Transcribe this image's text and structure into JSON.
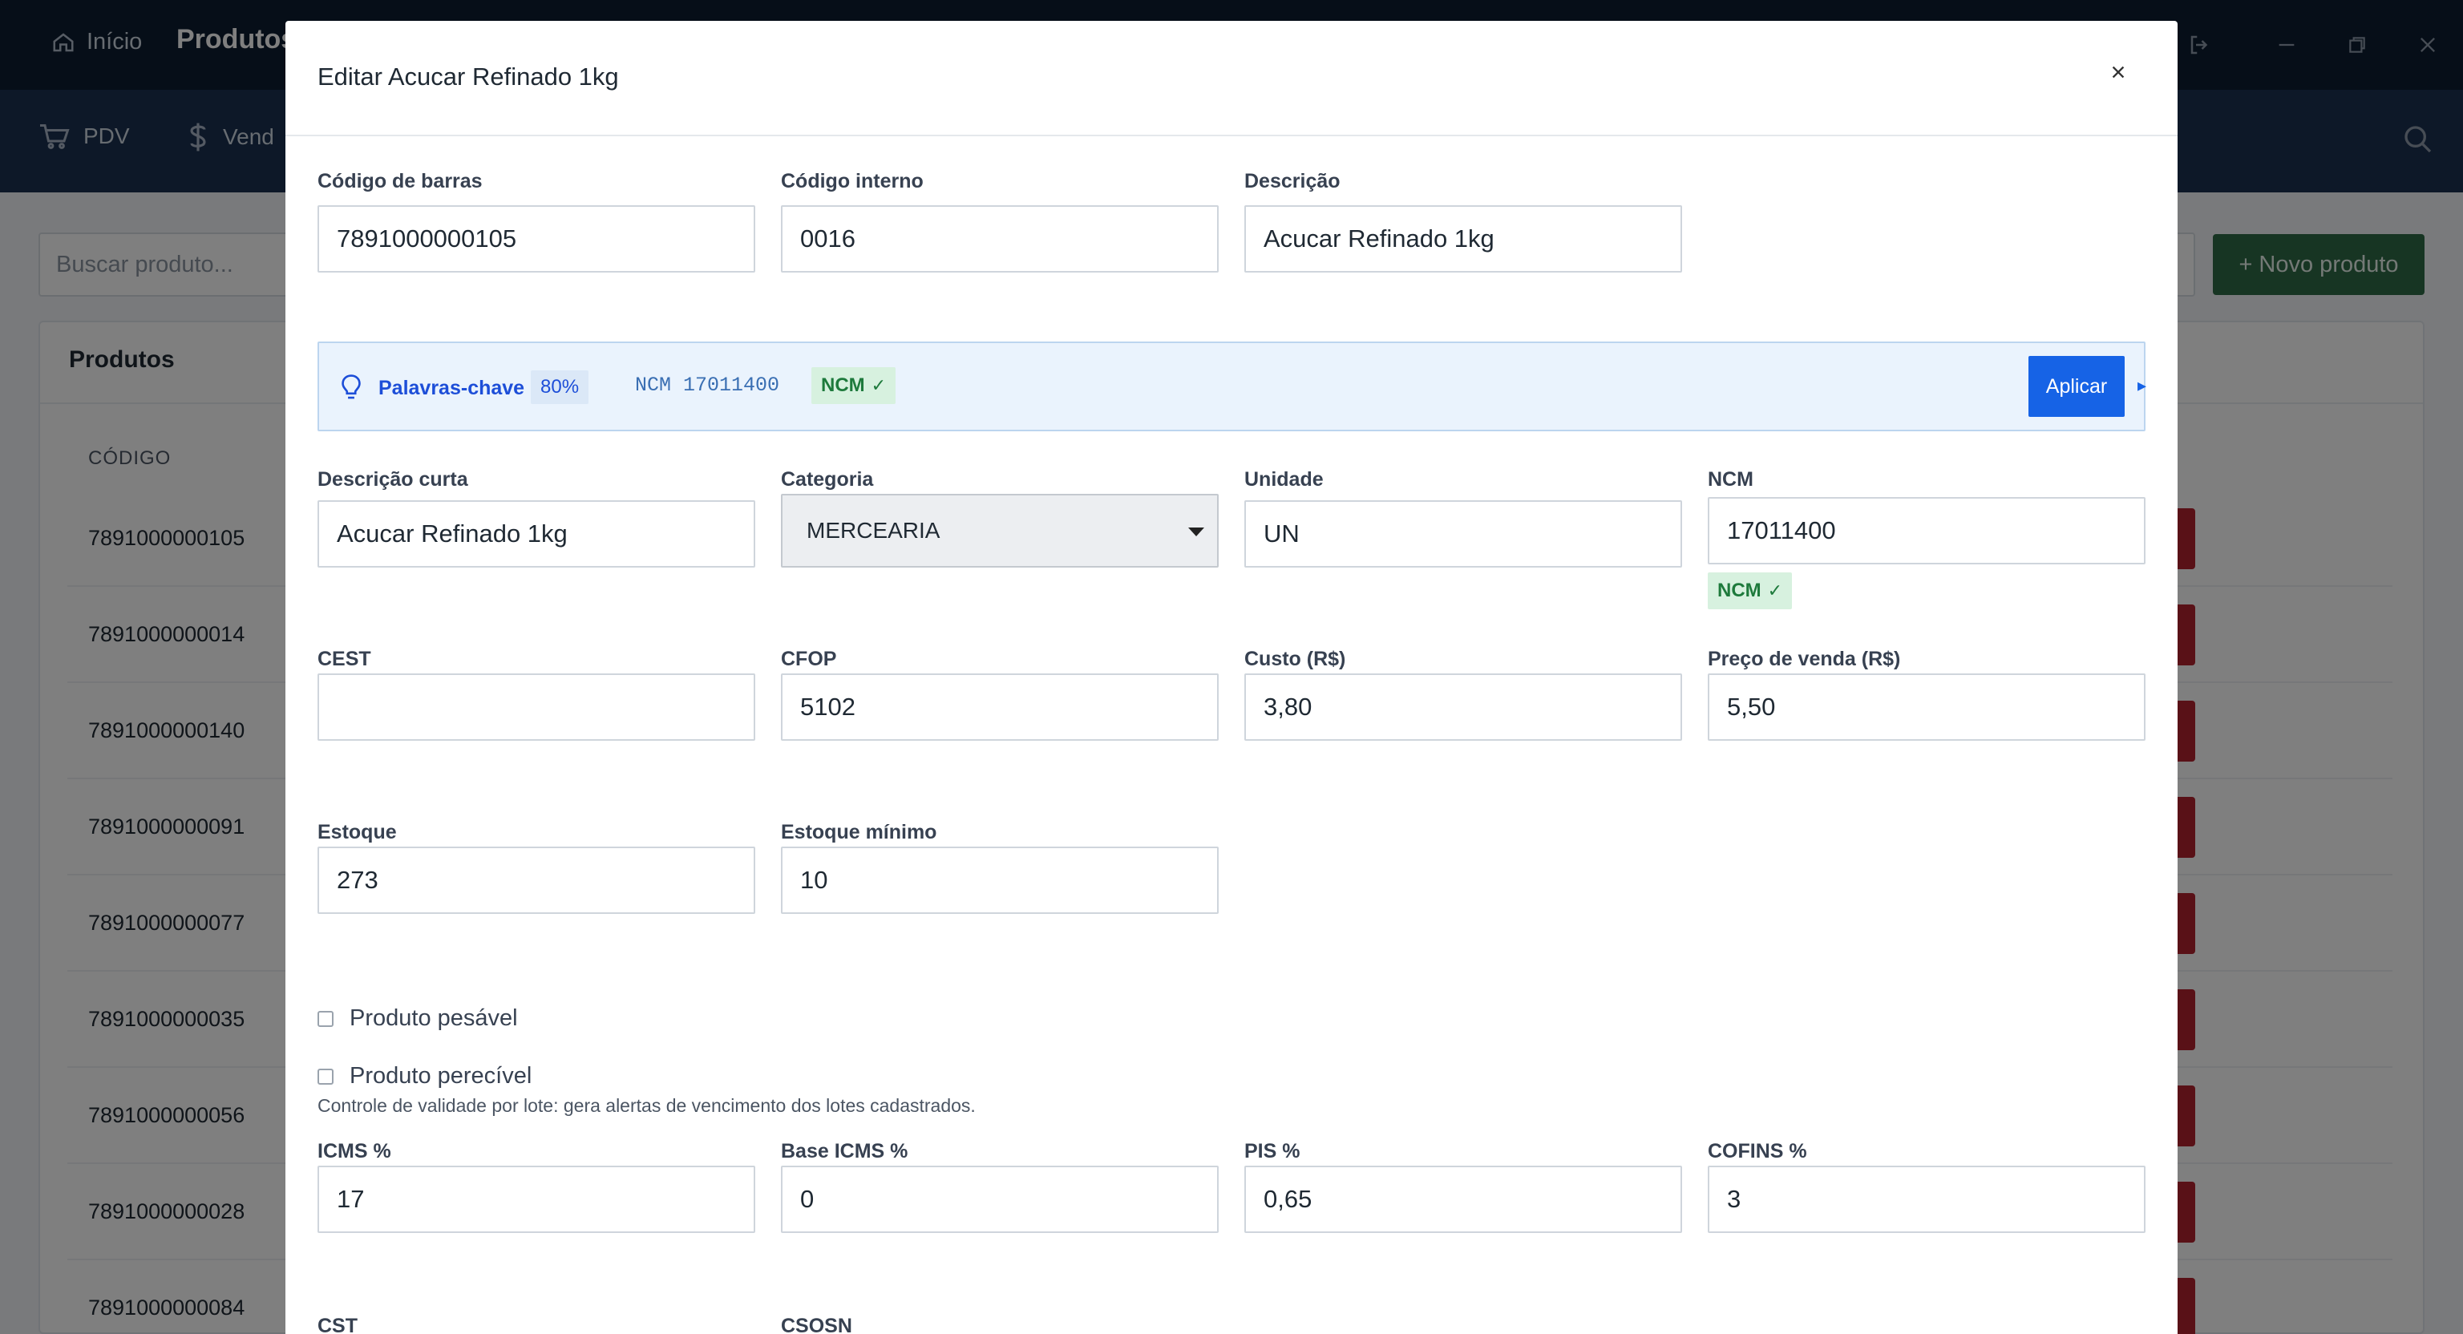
{
  "titlebar": {
    "home_label": "Início",
    "active_label": "Produtos"
  },
  "nav": {
    "items": [
      {
        "label": "PDV",
        "icon": "cart-icon"
      },
      {
        "label": "Vend",
        "icon": "dollar-icon"
      }
    ]
  },
  "background": {
    "search_placeholder": "Buscar produto...",
    "new_button": "+ Novo produto",
    "panel_title": "Produtos",
    "column_code": "CÓDIGO",
    "rows": [
      "7891000000105",
      "7891000000014",
      "7891000000140",
      "7891000000091",
      "7891000000077",
      "7891000000035",
      "7891000000056",
      "7891000000028",
      "7891000000084"
    ],
    "delete_color": "#b3232e"
  },
  "modal": {
    "title": "Editar Acucar Refinado 1kg",
    "close_label": "×",
    "fields": {
      "barcode": {
        "label": "Código de barras",
        "value": "7891000000105"
      },
      "internal_code": {
        "label": "Código interno",
        "value": "0016"
      },
      "description": {
        "label": "Descrição",
        "value": "Acucar Refinado 1kg"
      },
      "short_description": {
        "label": "Descrição curta",
        "value": "Acucar Refinado 1kg"
      },
      "category": {
        "label": "Categoria",
        "value": "MERCEARIA"
      },
      "unit": {
        "label": "Unidade",
        "value": "UN"
      },
      "ncm": {
        "label": "NCM",
        "value": "17011400",
        "badge": "NCM"
      },
      "cest": {
        "label": "CEST",
        "value": ""
      },
      "cfop": {
        "label": "CFOP",
        "value": "5102"
      },
      "cost": {
        "label": "Custo (R$)",
        "value": "3,80"
      },
      "price": {
        "label": "Preço de venda (R$)",
        "value": "5,50"
      },
      "stock": {
        "label": "Estoque",
        "value": "273"
      },
      "min_stock": {
        "label": "Estoque mínimo",
        "value": "10"
      },
      "icms": {
        "label": "ICMS %",
        "value": "17"
      },
      "base_icms": {
        "label": "Base ICMS %",
        "value": "0"
      },
      "pis": {
        "label": "PIS %",
        "value": "0,65"
      },
      "cofins": {
        "label": "COFINS %",
        "value": "3"
      },
      "cst": {
        "label": "CST"
      },
      "csosn": {
        "label": "CSOSN"
      }
    },
    "suggestion": {
      "label": "Palavras-chave",
      "confidence": "80%",
      "ncm_text": "NCM 17011400",
      "badge": "NCM",
      "apply_label": "Aplicar",
      "expand_glyph": "▸"
    },
    "checkboxes": {
      "weighable": "Produto pesável",
      "perishable": "Produto perecível"
    },
    "perishable_help": "Controle de validade por lote: gera alertas de vencimento dos lotes cadastrados.",
    "accent_color": "#1663e6",
    "success_color": "#1e7a3c"
  }
}
